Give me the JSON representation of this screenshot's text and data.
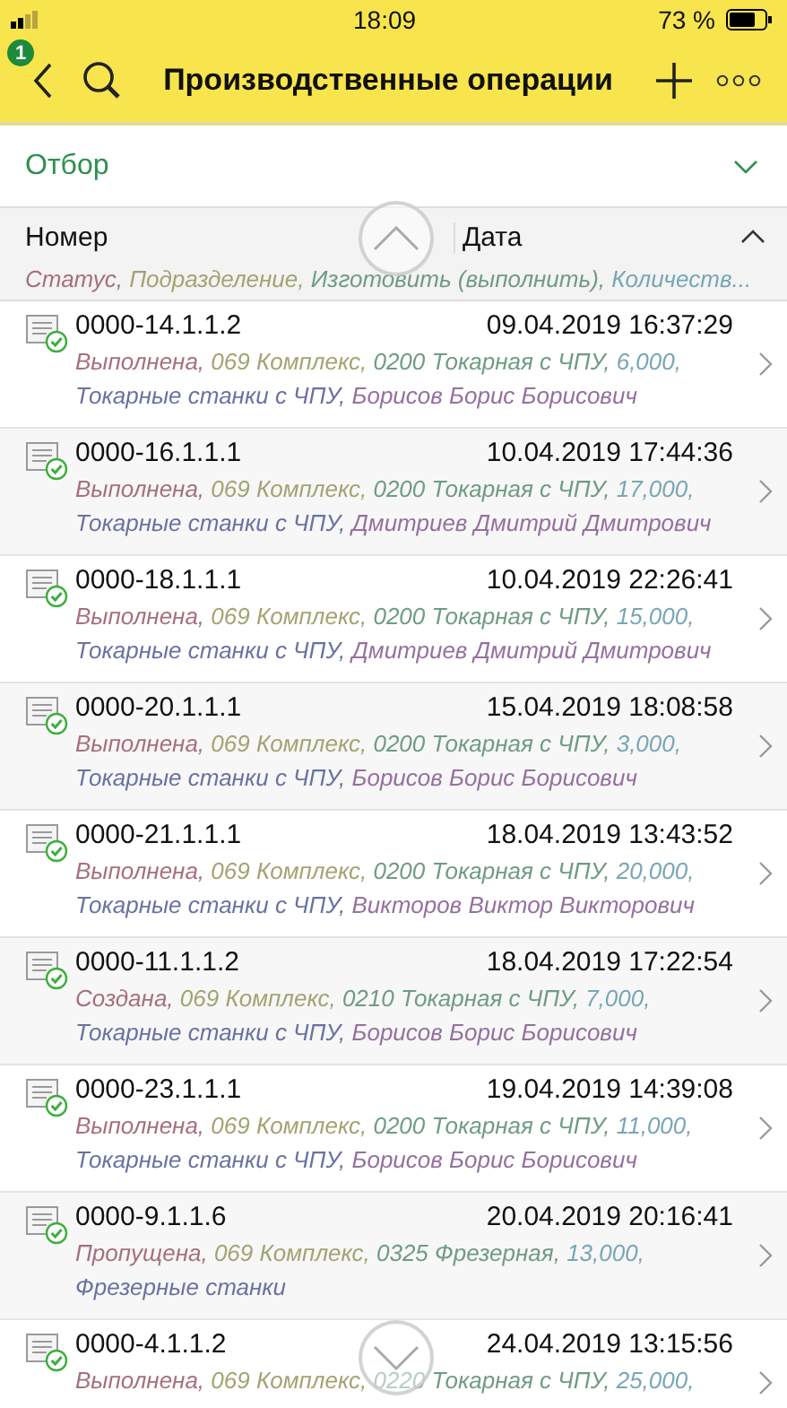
{
  "status_bar": {
    "time": "18:09",
    "battery": "73 %"
  },
  "nav": {
    "badge": "1",
    "title": "Производственные операции"
  },
  "filter": {
    "label": "Отбор"
  },
  "columns": [
    "Номер",
    "Дата"
  ],
  "subheader": [
    {
      "kind": "status",
      "text": "Статус, "
    },
    {
      "kind": "division",
      "text": "Подразделение, "
    },
    {
      "kind": "operation",
      "text": "Изготовить (выполнить), "
    },
    {
      "kind": "quantity",
      "text": "Количеств..."
    }
  ],
  "rows": [
    {
      "number": "0000-14.1.1.2",
      "date": "09.04.2019 16:37:29",
      "lines": [
        [
          {
            "kind": "status",
            "text": "Выполнена, "
          },
          {
            "kind": "division",
            "text": "069 Комплекс, "
          },
          {
            "kind": "operation",
            "text": "0200 Токарная с ЧПУ, "
          },
          {
            "kind": "quantity",
            "text": "6,000,"
          }
        ],
        [
          {
            "kind": "workcenter",
            "text": "Токарные станки с ЧПУ, "
          },
          {
            "kind": "employee",
            "text": "Борисов Борис Борисович"
          }
        ]
      ]
    },
    {
      "number": "0000-16.1.1.1",
      "date": "10.04.2019 17:44:36",
      "lines": [
        [
          {
            "kind": "status",
            "text": "Выполнена, "
          },
          {
            "kind": "division",
            "text": "069 Комплекс, "
          },
          {
            "kind": "operation",
            "text": "0200 Токарная с ЧПУ, "
          },
          {
            "kind": "quantity",
            "text": "17,000,"
          }
        ],
        [
          {
            "kind": "workcenter",
            "text": "Токарные станки с ЧПУ, "
          },
          {
            "kind": "employee",
            "text": "Дмитриев Дмитрий Дмитрович"
          }
        ]
      ]
    },
    {
      "number": "0000-18.1.1.1",
      "date": "10.04.2019 22:26:41",
      "lines": [
        [
          {
            "kind": "status",
            "text": "Выполнена, "
          },
          {
            "kind": "division",
            "text": "069 Комплекс, "
          },
          {
            "kind": "operation",
            "text": "0200 Токарная с ЧПУ, "
          },
          {
            "kind": "quantity",
            "text": "15,000,"
          }
        ],
        [
          {
            "kind": "workcenter",
            "text": "Токарные станки с ЧПУ, "
          },
          {
            "kind": "employee",
            "text": "Дмитриев Дмитрий Дмитрович"
          }
        ]
      ]
    },
    {
      "number": "0000-20.1.1.1",
      "date": "15.04.2019 18:08:58",
      "lines": [
        [
          {
            "kind": "status",
            "text": "Выполнена, "
          },
          {
            "kind": "division",
            "text": "069 Комплекс, "
          },
          {
            "kind": "operation",
            "text": "0200 Токарная с ЧПУ, "
          },
          {
            "kind": "quantity",
            "text": "3,000,"
          }
        ],
        [
          {
            "kind": "workcenter",
            "text": "Токарные станки с ЧПУ, "
          },
          {
            "kind": "employee",
            "text": "Борисов Борис Борисович"
          }
        ]
      ]
    },
    {
      "number": "0000-21.1.1.1",
      "date": "18.04.2019 13:43:52",
      "lines": [
        [
          {
            "kind": "status",
            "text": "Выполнена, "
          },
          {
            "kind": "division",
            "text": "069 Комплекс, "
          },
          {
            "kind": "operation",
            "text": "0200 Токарная с ЧПУ, "
          },
          {
            "kind": "quantity",
            "text": "20,000,"
          }
        ],
        [
          {
            "kind": "workcenter",
            "text": "Токарные станки с ЧПУ, "
          },
          {
            "kind": "employee",
            "text": "Викторов Виктор Викторович"
          }
        ]
      ]
    },
    {
      "number": "0000-11.1.1.2",
      "date": "18.04.2019 17:22:54",
      "lines": [
        [
          {
            "kind": "status",
            "text": "Создана, "
          },
          {
            "kind": "division",
            "text": "069 Комплекс, "
          },
          {
            "kind": "operation",
            "text": "0210 Токарная с ЧПУ, "
          },
          {
            "kind": "quantity",
            "text": "7,000,"
          }
        ],
        [
          {
            "kind": "workcenter",
            "text": "Токарные станки с ЧПУ, "
          },
          {
            "kind": "employee",
            "text": "Борисов Борис Борисович"
          }
        ]
      ]
    },
    {
      "number": "0000-23.1.1.1",
      "date": "19.04.2019 14:39:08",
      "lines": [
        [
          {
            "kind": "status",
            "text": "Выполнена, "
          },
          {
            "kind": "division",
            "text": "069 Комплекс, "
          },
          {
            "kind": "operation",
            "text": "0200 Токарная с ЧПУ, "
          },
          {
            "kind": "quantity",
            "text": "11,000,"
          }
        ],
        [
          {
            "kind": "workcenter",
            "text": "Токарные станки с ЧПУ, "
          },
          {
            "kind": "employee",
            "text": "Борисов Борис Борисович"
          }
        ]
      ]
    },
    {
      "number": "0000-9.1.1.6",
      "date": "20.04.2019 20:16:41",
      "lines": [
        [
          {
            "kind": "status",
            "text": "Пропущена, "
          },
          {
            "kind": "division",
            "text": "069 Комплекс, "
          },
          {
            "kind": "operation",
            "text": "0325 Фрезерная, "
          },
          {
            "kind": "quantity",
            "text": "13,000,"
          }
        ],
        [
          {
            "kind": "workcenter",
            "text": "Фрезерные станки"
          }
        ]
      ]
    },
    {
      "number": "0000-4.1.1.2",
      "date": "24.04.2019 13:15:56",
      "lines": [
        [
          {
            "kind": "status",
            "text": "Выполнена, "
          },
          {
            "kind": "division",
            "text": "069 Комплекс, "
          },
          {
            "kind": "operation",
            "text": "0220 Токарная с ЧПУ, "
          },
          {
            "kind": "quantity",
            "text": "25,000,"
          }
        ]
      ]
    }
  ]
}
